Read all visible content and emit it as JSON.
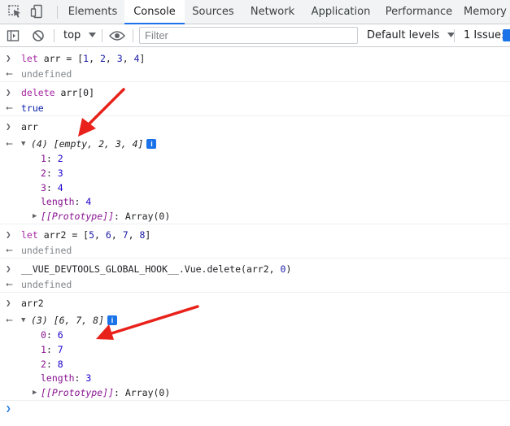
{
  "tabs": [
    "Elements",
    "Console",
    "Sources",
    "Network",
    "Application",
    "Performance",
    "Memory"
  ],
  "toolbar": {
    "context": "top",
    "filter_placeholder": "Filter",
    "levels": "Default levels",
    "issues": "1 Issue:"
  },
  "console": {
    "in1": {
      "kw": "let",
      "rest": " arr = [",
      "n1": "1",
      "n2": "2",
      "n3": "3",
      "n4": "4",
      "end": "]"
    },
    "out1": "undefined",
    "in2": {
      "kw": "delete",
      "rest": " arr[0]"
    },
    "out2": "true",
    "in3": "arr",
    "out3": {
      "summary": "(4) [empty, 2, 3, 4]",
      "props": [
        {
          "key": "1",
          "value": "2"
        },
        {
          "key": "2",
          "value": "3"
        },
        {
          "key": "3",
          "value": "4"
        },
        {
          "key": "length",
          "value": "4"
        }
      ],
      "proto_key": "[[Prototype]]",
      "proto_val": "Array(0)"
    },
    "in4": {
      "kw": "let",
      "rest": " arr2 = [",
      "n1": "5",
      "n2": "6",
      "n3": "7",
      "n4": "8",
      "end": "]"
    },
    "out4": "undefined",
    "in5": {
      "pre": "__VUE_DEVTOOLS_GLOBAL_HOOK__.Vue.",
      "kw": "delete",
      "args": "(arr2, ",
      "n": "0",
      "end": ")"
    },
    "out5": "undefined",
    "in6": "arr2",
    "out6": {
      "summary": "(3) [6, 7, 8]",
      "props": [
        {
          "key": "0",
          "value": "6"
        },
        {
          "key": "1",
          "value": "7"
        },
        {
          "key": "2",
          "value": "8"
        },
        {
          "key": "length",
          "value": "3"
        }
      ],
      "proto_key": "[[Prototype]]",
      "proto_val": "Array(0)"
    },
    "info_glyph": "i"
  },
  "colors": {
    "accent": "#1a73e8",
    "annotation_arrow": "#e8221b"
  },
  "icons": [
    "inspect-element-icon",
    "device-toolbar-icon",
    "sidebar-toggle-icon",
    "clear-console-icon",
    "eye-icon",
    "dropdown-icon"
  ]
}
